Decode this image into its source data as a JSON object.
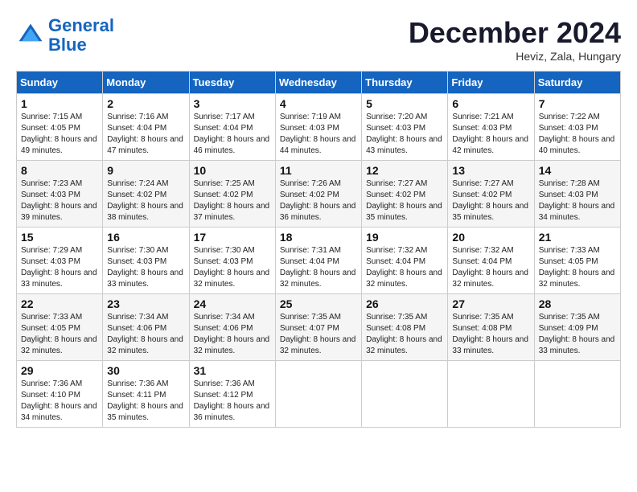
{
  "header": {
    "logo_line1": "General",
    "logo_line2": "Blue",
    "month_title": "December 2024",
    "location": "Heviz, Zala, Hungary"
  },
  "days_of_week": [
    "Sunday",
    "Monday",
    "Tuesday",
    "Wednesday",
    "Thursday",
    "Friday",
    "Saturday"
  ],
  "weeks": [
    [
      {
        "day": "1",
        "info": "Sunrise: 7:15 AM\nSunset: 4:05 PM\nDaylight: 8 hours and 49 minutes."
      },
      {
        "day": "2",
        "info": "Sunrise: 7:16 AM\nSunset: 4:04 PM\nDaylight: 8 hours and 47 minutes."
      },
      {
        "day": "3",
        "info": "Sunrise: 7:17 AM\nSunset: 4:04 PM\nDaylight: 8 hours and 46 minutes."
      },
      {
        "day": "4",
        "info": "Sunrise: 7:19 AM\nSunset: 4:03 PM\nDaylight: 8 hours and 44 minutes."
      },
      {
        "day": "5",
        "info": "Sunrise: 7:20 AM\nSunset: 4:03 PM\nDaylight: 8 hours and 43 minutes."
      },
      {
        "day": "6",
        "info": "Sunrise: 7:21 AM\nSunset: 4:03 PM\nDaylight: 8 hours and 42 minutes."
      },
      {
        "day": "7",
        "info": "Sunrise: 7:22 AM\nSunset: 4:03 PM\nDaylight: 8 hours and 40 minutes."
      }
    ],
    [
      {
        "day": "8",
        "info": "Sunrise: 7:23 AM\nSunset: 4:03 PM\nDaylight: 8 hours and 39 minutes."
      },
      {
        "day": "9",
        "info": "Sunrise: 7:24 AM\nSunset: 4:02 PM\nDaylight: 8 hours and 38 minutes."
      },
      {
        "day": "10",
        "info": "Sunrise: 7:25 AM\nSunset: 4:02 PM\nDaylight: 8 hours and 37 minutes."
      },
      {
        "day": "11",
        "info": "Sunrise: 7:26 AM\nSunset: 4:02 PM\nDaylight: 8 hours and 36 minutes."
      },
      {
        "day": "12",
        "info": "Sunrise: 7:27 AM\nSunset: 4:02 PM\nDaylight: 8 hours and 35 minutes."
      },
      {
        "day": "13",
        "info": "Sunrise: 7:27 AM\nSunset: 4:02 PM\nDaylight: 8 hours and 35 minutes."
      },
      {
        "day": "14",
        "info": "Sunrise: 7:28 AM\nSunset: 4:03 PM\nDaylight: 8 hours and 34 minutes."
      }
    ],
    [
      {
        "day": "15",
        "info": "Sunrise: 7:29 AM\nSunset: 4:03 PM\nDaylight: 8 hours and 33 minutes."
      },
      {
        "day": "16",
        "info": "Sunrise: 7:30 AM\nSunset: 4:03 PM\nDaylight: 8 hours and 33 minutes."
      },
      {
        "day": "17",
        "info": "Sunrise: 7:30 AM\nSunset: 4:03 PM\nDaylight: 8 hours and 32 minutes."
      },
      {
        "day": "18",
        "info": "Sunrise: 7:31 AM\nSunset: 4:04 PM\nDaylight: 8 hours and 32 minutes."
      },
      {
        "day": "19",
        "info": "Sunrise: 7:32 AM\nSunset: 4:04 PM\nDaylight: 8 hours and 32 minutes."
      },
      {
        "day": "20",
        "info": "Sunrise: 7:32 AM\nSunset: 4:04 PM\nDaylight: 8 hours and 32 minutes."
      },
      {
        "day": "21",
        "info": "Sunrise: 7:33 AM\nSunset: 4:05 PM\nDaylight: 8 hours and 32 minutes."
      }
    ],
    [
      {
        "day": "22",
        "info": "Sunrise: 7:33 AM\nSunset: 4:05 PM\nDaylight: 8 hours and 32 minutes."
      },
      {
        "day": "23",
        "info": "Sunrise: 7:34 AM\nSunset: 4:06 PM\nDaylight: 8 hours and 32 minutes."
      },
      {
        "day": "24",
        "info": "Sunrise: 7:34 AM\nSunset: 4:06 PM\nDaylight: 8 hours and 32 minutes."
      },
      {
        "day": "25",
        "info": "Sunrise: 7:35 AM\nSunset: 4:07 PM\nDaylight: 8 hours and 32 minutes."
      },
      {
        "day": "26",
        "info": "Sunrise: 7:35 AM\nSunset: 4:08 PM\nDaylight: 8 hours and 32 minutes."
      },
      {
        "day": "27",
        "info": "Sunrise: 7:35 AM\nSunset: 4:08 PM\nDaylight: 8 hours and 33 minutes."
      },
      {
        "day": "28",
        "info": "Sunrise: 7:35 AM\nSunset: 4:09 PM\nDaylight: 8 hours and 33 minutes."
      }
    ],
    [
      {
        "day": "29",
        "info": "Sunrise: 7:36 AM\nSunset: 4:10 PM\nDaylight: 8 hours and 34 minutes."
      },
      {
        "day": "30",
        "info": "Sunrise: 7:36 AM\nSunset: 4:11 PM\nDaylight: 8 hours and 35 minutes."
      },
      {
        "day": "31",
        "info": "Sunrise: 7:36 AM\nSunset: 4:12 PM\nDaylight: 8 hours and 36 minutes."
      },
      {
        "day": "",
        "info": ""
      },
      {
        "day": "",
        "info": ""
      },
      {
        "day": "",
        "info": ""
      },
      {
        "day": "",
        "info": ""
      }
    ]
  ]
}
